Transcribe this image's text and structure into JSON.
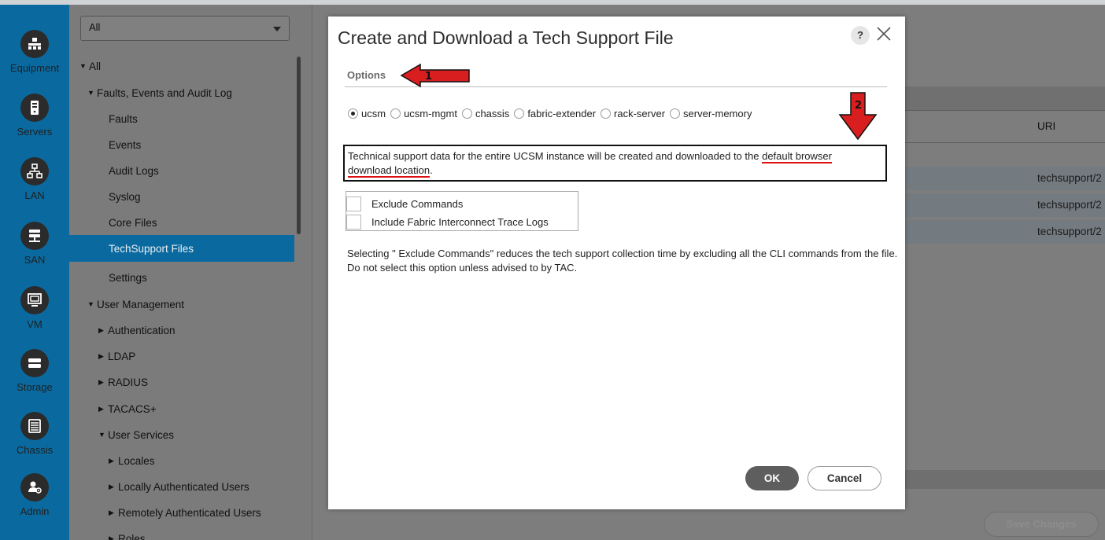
{
  "rail": {
    "items": [
      {
        "label": "Equipment",
        "icon": "equipment-icon"
      },
      {
        "label": "Servers",
        "icon": "server-icon"
      },
      {
        "label": "LAN",
        "icon": "lan-icon"
      },
      {
        "label": "SAN",
        "icon": "san-icon"
      },
      {
        "label": "VM",
        "icon": "vm-icon"
      },
      {
        "label": "Storage",
        "icon": "storage-icon"
      },
      {
        "label": "Chassis",
        "icon": "chassis-icon"
      },
      {
        "label": "Admin",
        "icon": "admin-icon"
      }
    ]
  },
  "tree": {
    "filter_value": "All",
    "items": [
      {
        "label": "All",
        "expand": "open"
      },
      {
        "label": "Faults, Events and Audit Log",
        "expand": "open"
      },
      {
        "label": "Faults",
        "expand": "none"
      },
      {
        "label": "Events",
        "expand": "none"
      },
      {
        "label": "Audit Logs",
        "expand": "none"
      },
      {
        "label": "Syslog",
        "expand": "none"
      },
      {
        "label": "Core Files",
        "expand": "none"
      },
      {
        "label": "TechSupport Files",
        "expand": "none",
        "selected": true
      },
      {
        "label": "Settings",
        "expand": "none"
      },
      {
        "label": "User Management",
        "expand": "open"
      },
      {
        "label": "Authentication",
        "expand": "closed"
      },
      {
        "label": "LDAP",
        "expand": "closed"
      },
      {
        "label": "RADIUS",
        "expand": "closed"
      },
      {
        "label": "TACACS+",
        "expand": "closed"
      },
      {
        "label": "User Services",
        "expand": "open"
      },
      {
        "label": "Locales",
        "expand": "closed"
      },
      {
        "label": "Locally Authenticated Users",
        "expand": "closed"
      },
      {
        "label": "Remotely Authenticated Users",
        "expand": "closed"
      },
      {
        "label": "Roles",
        "expand": "closed"
      }
    ]
  },
  "main": {
    "uri_header": "URI",
    "uri_rows": [
      "techsupport/2",
      "techsupport/2",
      "techsupport/2"
    ],
    "save_label": "Save Changes"
  },
  "dialog": {
    "title": "Create and Download a Tech Support File",
    "help_label": "?",
    "tab_label": "Options",
    "radio_options": [
      {
        "label": "ucsm",
        "checked": true
      },
      {
        "label": "ucsm-mgmt",
        "checked": false
      },
      {
        "label": "chassis",
        "checked": false
      },
      {
        "label": "fabric-extender",
        "checked": false
      },
      {
        "label": "rack-server",
        "checked": false
      },
      {
        "label": "server-memory",
        "checked": false
      }
    ],
    "description_part1": "Technical support data for the entire UCSM instance will be created and downloaded to the ",
    "description_highlight1": "default browser",
    "description_highlight2": "download location",
    "description_end": ".",
    "checkboxes": [
      {
        "label": "Exclude Commands",
        "checked": false
      },
      {
        "label": "Include Fabric Interconnect Trace Logs",
        "checked": false
      }
    ],
    "note": "Selecting \" Exclude Commands\"  reduces the tech support collection time by excluding all the CLI commands from the file. Do not select this option unless advised to by TAC.",
    "ok_label": "OK",
    "cancel_label": "Cancel"
  },
  "annotations": {
    "arrow1_number": "1",
    "arrow2_number": "2",
    "arrow_color": "#d81e1e"
  }
}
